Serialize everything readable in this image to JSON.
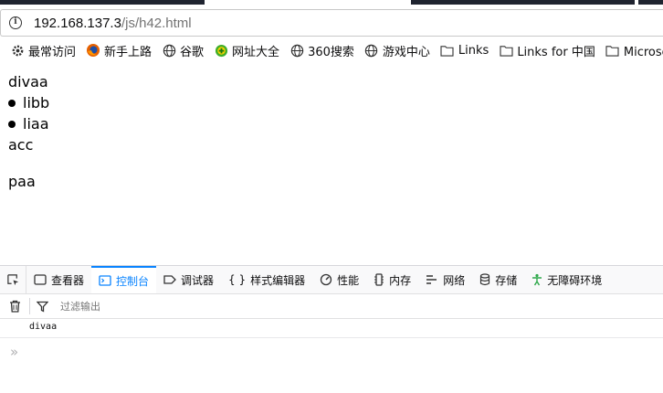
{
  "browser": {
    "url_host": "192.168.137.3",
    "url_path": "/js/h42.html"
  },
  "bookmarks": [
    {
      "label": "最常访问",
      "icon": "gear-icon"
    },
    {
      "label": "新手上路",
      "icon": "firefox-icon"
    },
    {
      "label": "谷歌",
      "icon": "globe-icon"
    },
    {
      "label": "网址大全",
      "icon": "plus-icon"
    },
    {
      "label": "360搜索",
      "icon": "globe-icon"
    },
    {
      "label": "游戏中心",
      "icon": "globe-icon"
    },
    {
      "label": "Links",
      "icon": "folder-icon"
    },
    {
      "label": "Links for 中国",
      "icon": "folder-icon"
    },
    {
      "label": "Microsoft 网",
      "icon": "folder-icon"
    }
  ],
  "page": {
    "div_text": "divaa",
    "list_items": [
      "libb",
      "liaa"
    ],
    "after_list": "acc",
    "paragraph": "paa"
  },
  "devtools": {
    "tabs": [
      {
        "label": "查看器",
        "icon": "inspector-icon"
      },
      {
        "label": "控制台",
        "icon": "console-icon"
      },
      {
        "label": "调试器",
        "icon": "debugger-icon"
      },
      {
        "label": "样式编辑器",
        "icon": "braces-icon"
      },
      {
        "label": "性能",
        "icon": "performance-icon"
      },
      {
        "label": "内存",
        "icon": "memory-icon"
      },
      {
        "label": "网络",
        "icon": "network-icon"
      },
      {
        "label": "存储",
        "icon": "storage-icon"
      },
      {
        "label": "无障碍环境",
        "icon": "accessibility-icon"
      }
    ],
    "active_tab": "控制台",
    "filter_placeholder": "过滤输出",
    "log_messages": [
      "divaa"
    ],
    "prompt_symbol": "»",
    "accent_color": "#0a84ff"
  }
}
